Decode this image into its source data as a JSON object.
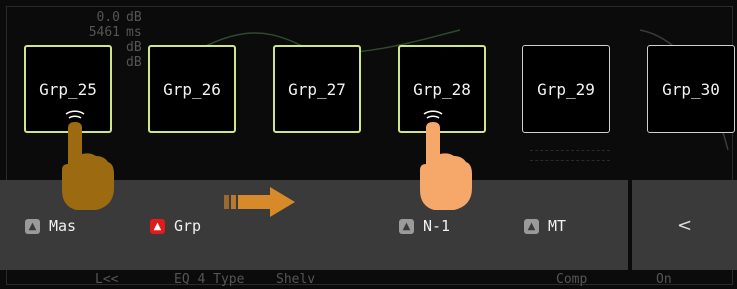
{
  "background": {
    "readouts": [
      {
        "value": "0.0",
        "unit": "dB"
      },
      {
        "value": "5461",
        "unit": "ms"
      },
      {
        "value": "",
        "unit": "dB"
      },
      {
        "value": "",
        "unit": "dB"
      }
    ],
    "bottom_labels": [
      "L<<",
      "EQ 4 Type",
      "Shelv",
      "Comp",
      "On"
    ]
  },
  "groups": [
    {
      "label": "Grp_25",
      "state": "selected"
    },
    {
      "label": "Grp_26",
      "state": "selected"
    },
    {
      "label": "Grp_27",
      "state": "selected"
    },
    {
      "label": "Grp_28",
      "state": "selected"
    },
    {
      "label": "Grp_29",
      "state": "unselected"
    },
    {
      "label": "Grp_30",
      "state": "unselected"
    }
  ],
  "bar": {
    "items": [
      {
        "label": "Mas",
        "checked": false
      },
      {
        "label": "Grp",
        "checked": true
      },
      {
        "label": "N-1",
        "checked": false
      },
      {
        "label": "MT",
        "checked": false
      }
    ],
    "nav_label": "<"
  },
  "colors": {
    "selected_border": "#cfe68a",
    "checked": "#e01b1b",
    "hand_dark": "#9c6a10",
    "hand_light": "#f5a86a",
    "arrow": "#d68a2a"
  },
  "icons": {
    "check": "chevron-up-icon",
    "swipe_arrow": "arrow-right-icon",
    "hand_1": "pointing-hand-icon",
    "hand_2": "pointing-hand-icon"
  }
}
